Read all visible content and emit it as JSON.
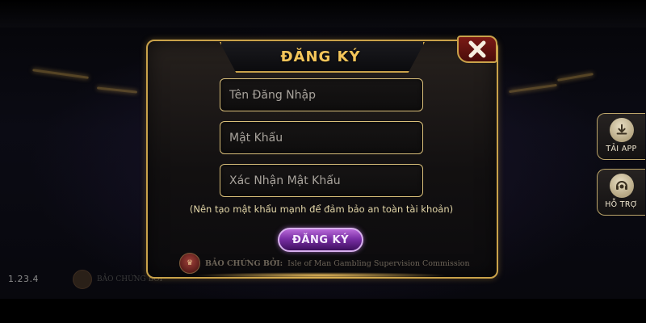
{
  "app": {
    "version": "1.23.4",
    "background_certification": "BẢO CHỨNG BỞI"
  },
  "dialog": {
    "title": "ĐĂNG KÝ",
    "close_icon": "close-x-icon",
    "fields": {
      "username_placeholder": "Tên Đăng Nhập",
      "password_placeholder": "Mật Khẩu",
      "confirm_password_placeholder": "Xác Nhận Mật Khẩu"
    },
    "hint": "(Nên tạo mật khẩu mạnh để đảm bảo an toàn tài khoản)",
    "submit_label": "ĐĂNG KÝ",
    "certification": {
      "prefix": "BẢO CHỨNG BỞI:",
      "authority": "Isle of Man Gambling Supervision Commission"
    }
  },
  "side_buttons": {
    "download_label": "TẢI APP",
    "download_icon": "download-icon",
    "support_label": "HỖ TRỢ",
    "support_icon": "headset-support-icon"
  },
  "colors": {
    "gold_border": "#c9a24a",
    "title_gold": "#f3c55a",
    "close_red": "#7a1a15",
    "button_purple": "#7a2fa6"
  }
}
